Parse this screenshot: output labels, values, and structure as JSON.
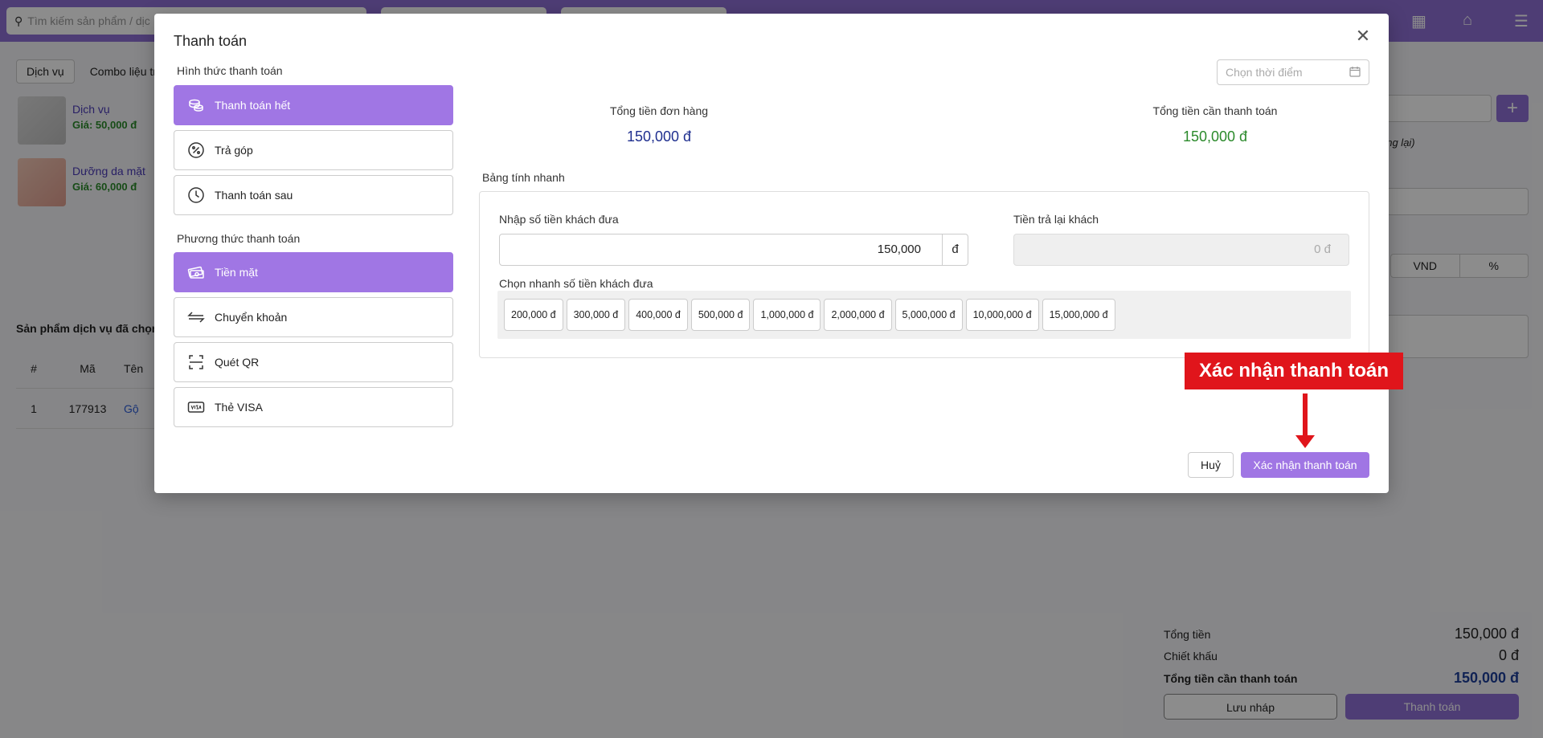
{
  "background": {
    "search_placeholder": "Tìm kiếm sản phẩm / dịc",
    "tabs": [
      "Dịch vụ",
      "Combo liệu trìn"
    ],
    "services": [
      {
        "name": "Dịch vụ",
        "price": "Giá: 50,000 đ"
      },
      {
        "name": "Dưỡng da mặt",
        "price": "Giá: 60,000 đ"
      }
    ],
    "selected_title": "Sản phẩm dịch vụ đã chọn",
    "table_headers": [
      "#",
      "Mã",
      "Tên"
    ],
    "table_rows": [
      [
        "1",
        "177913",
        "Gộ"
      ]
    ],
    "italic_note": "ăng lại)",
    "unit_toggle": [
      "VND",
      "%"
    ],
    "summary": {
      "total_label": "Tổng tiền",
      "total_value": "150,000 đ",
      "discount_label": "Chiết khấu",
      "discount_value": "0 đ",
      "due_label": "Tổng tiền cần thanh toán",
      "due_value": "150,000 đ"
    },
    "draft_button": "Lưu nháp",
    "pay_button": "Thanh toán"
  },
  "modal": {
    "title": "Thanh toán",
    "close_glyph": "✕",
    "payment_type_label": "Hình thức thanh toán",
    "payment_types": [
      {
        "label": "Thanh toán hết",
        "icon": "coins-icon",
        "active": true
      },
      {
        "label": "Trả góp",
        "icon": "percent-badge-icon",
        "active": false
      },
      {
        "label": "Thanh toán sau",
        "icon": "clock-icon",
        "active": false
      }
    ],
    "payment_method_label": "Phương thức thanh toán",
    "payment_methods": [
      {
        "label": "Tiền mặt",
        "icon": "cash-icon",
        "active": true
      },
      {
        "label": "Chuyển khoản",
        "icon": "transfer-icon",
        "active": false
      },
      {
        "label": "Quét QR",
        "icon": "qr-scan-icon",
        "active": false
      },
      {
        "label": "Thẻ VISA",
        "icon": "visa-card-icon",
        "active": false
      }
    ],
    "date_placeholder": "Chọn thời điểm",
    "order_total_label": "Tổng tiền đơn hàng",
    "order_total_value": "150,000 đ",
    "amount_due_label": "Tổng tiền cần thanh toán",
    "amount_due_value": "150,000 đ",
    "quick_calc_label": "Bảng tính nhanh",
    "cash_input_label": "Nhập số tiền khách đưa",
    "cash_input_value": "150,000",
    "cash_unit": "đ",
    "change_label": "Tiền trả lại khách",
    "change_value": "0 đ",
    "quick_pick_label": "Chọn nhanh số tiền khách đưa",
    "quick_amounts": [
      "200,000 đ",
      "300,000 đ",
      "400,000 đ",
      "500,000 đ",
      "1,000,000 đ",
      "2,000,000 đ",
      "5,000,000 đ",
      "10,000,000 đ",
      "15,000,000 đ"
    ],
    "cancel_label": "Huỷ",
    "confirm_label": "Xác nhận thanh toán"
  },
  "annotation": {
    "callout_text": "Xác nhận thanh toán",
    "color": "#e0151b"
  },
  "colors": {
    "accent": "#a076e4",
    "topbar": "#8e6fd6",
    "order_total": "#1f2f8f",
    "amount_due": "#2b8a2b"
  }
}
